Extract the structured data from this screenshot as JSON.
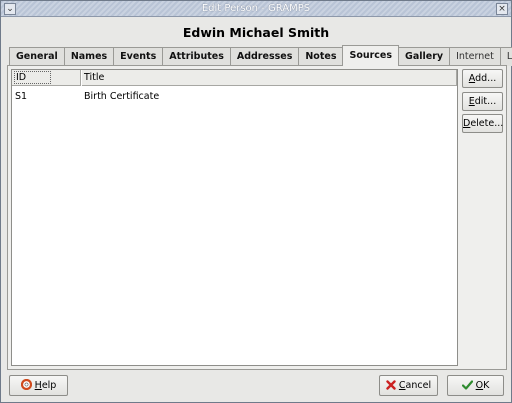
{
  "window": {
    "title": "Edit Person - GRAMPS",
    "menu_glyph": "⌄",
    "close_glyph": "×"
  },
  "person": {
    "name": "Edwin Michael Smith"
  },
  "tabs": [
    {
      "label": "General"
    },
    {
      "label": "Names"
    },
    {
      "label": "Events"
    },
    {
      "label": "Attributes"
    },
    {
      "label": "Addresses"
    },
    {
      "label": "Notes"
    },
    {
      "label": "Sources",
      "active": true
    },
    {
      "label": "Gallery"
    },
    {
      "label": "Internet"
    },
    {
      "label": "LDS"
    }
  ],
  "list": {
    "columns": {
      "id": "ID",
      "title": "Title"
    },
    "rows": [
      {
        "id": "S1",
        "title": "Birth Certificate"
      }
    ]
  },
  "actions": {
    "add": {
      "mnemonic": "A",
      "rest": "dd..."
    },
    "edit": {
      "mnemonic": "E",
      "rest": "dit..."
    },
    "delete": {
      "mnemonic": "D",
      "rest": "elete..."
    }
  },
  "bottom": {
    "help": {
      "mnemonic": "H",
      "rest": "elp",
      "icon": "help-lifebuoy-icon"
    },
    "cancel": {
      "mnemonic": "C",
      "rest": "ancel",
      "icon": "cancel-x-icon"
    },
    "ok": {
      "mnemonic": "O",
      "rest": "K",
      "icon": "ok-check-icon"
    }
  },
  "colors": {
    "title_bar": "#b9c4d6",
    "cancel_icon": "#cc2222",
    "ok_icon": "#2e8b2e",
    "help_icon": "#d04a1c"
  }
}
